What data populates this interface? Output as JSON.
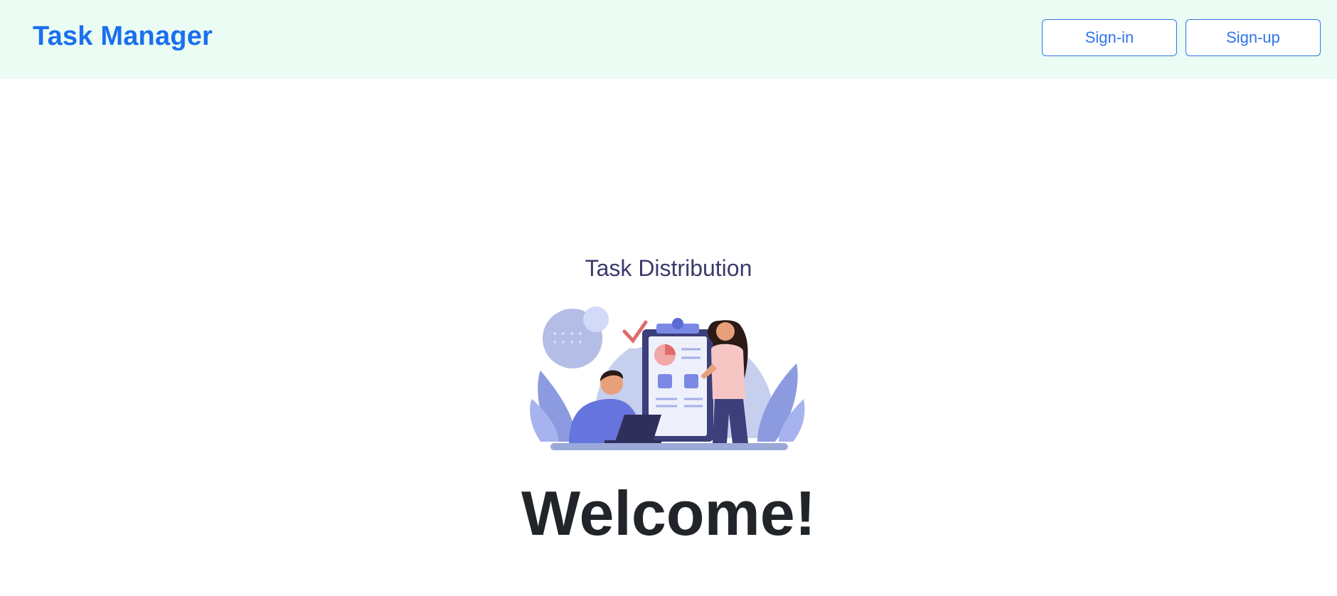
{
  "navbar": {
    "brand": "Task Manager",
    "signin_label": "Sign-in",
    "signup_label": "Sign-up"
  },
  "hero": {
    "illustration_title": "Task Distribution",
    "heading": "Welcome!"
  },
  "colors": {
    "navbar_bg": "#eafcf3",
    "brand": "#1a6ff0",
    "button_border": "#2f74ec",
    "heading": "#212529",
    "illustration_accent": "#7b88e6"
  },
  "icons": {
    "illustration": "task-distribution-illustration"
  }
}
